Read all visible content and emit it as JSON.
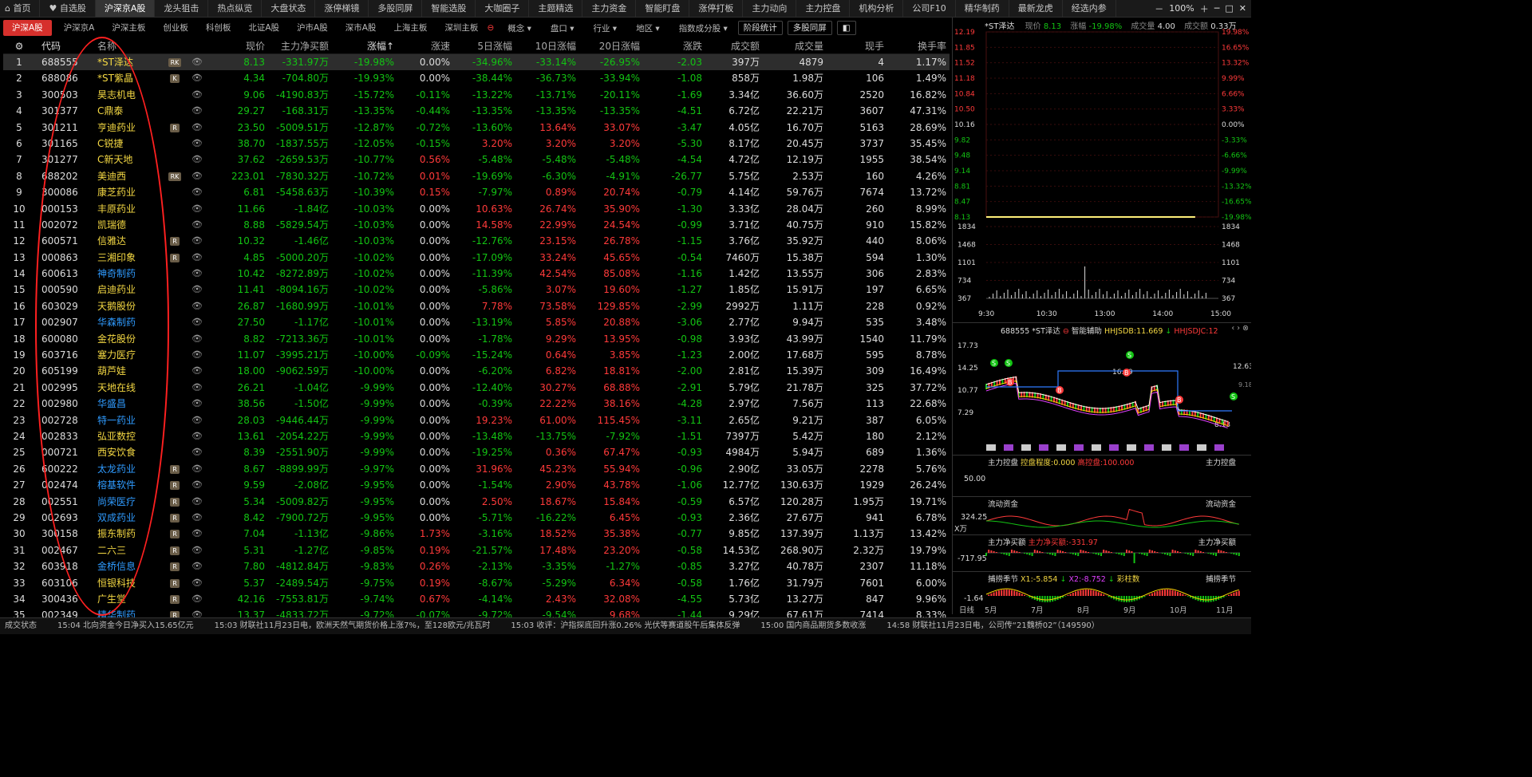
{
  "topnav": {
    "items": [
      "首页",
      "自选股",
      "沪深京A股",
      "龙头狙击",
      "热点纵览",
      "大盘状态",
      "涨停梯镜",
      "多股同屏",
      "智能选股",
      "大咖圈子",
      "主题精选",
      "主力资金",
      "智能盯盘",
      "涨停打板",
      "主力动向",
      "主力控盘",
      "机构分析",
      "公司F10",
      "精华制药",
      "最新龙虎",
      "经选内参"
    ],
    "active_index": 2,
    "zoom": "100%"
  },
  "subtabs": {
    "items": [
      "沪深A股",
      "沪深京A",
      "沪深主板",
      "创业板",
      "科创板",
      "北证A股",
      "沪市A股",
      "深市A股",
      "上海主板",
      "深圳主板"
    ],
    "active_index": 0,
    "dropdowns": [
      "概念",
      "盘口",
      "行业",
      "地区",
      "指数成分股"
    ],
    "buttons": [
      "阶段统计",
      "多股同屏"
    ]
  },
  "table": {
    "columns": [
      "代码",
      "名称",
      "现价",
      "主力净买额",
      "涨幅↑",
      "涨速",
      "5日涨幅",
      "10日涨幅",
      "20日涨幅",
      "涨跌",
      "成交额",
      "成交量",
      "现手",
      "换手率"
    ],
    "rows": [
      [
        "1",
        "688555",
        "*ST泽达",
        "RK",
        "8.13",
        "-331.97万",
        "-19.98%",
        "0.00%",
        "-34.96%",
        "-33.14%",
        "-26.95%",
        "-2.03",
        "397万",
        "4879",
        "4",
        "1.17%"
      ],
      [
        "2",
        "688086",
        "*ST紫晶",
        "K",
        "4.34",
        "-704.80万",
        "-19.93%",
        "0.00%",
        "-38.44%",
        "-36.73%",
        "-33.94%",
        "-1.08",
        "858万",
        "1.98万",
        "106",
        "1.49%"
      ],
      [
        "3",
        "300503",
        "昊志机电",
        "",
        "9.06",
        "-4190.83万",
        "-15.72%",
        "-0.11%",
        "-13.22%",
        "-13.71%",
        "-20.11%",
        "-1.69",
        "3.34亿",
        "36.60万",
        "2520",
        "16.82%"
      ],
      [
        "4",
        "301377",
        "C鼎泰",
        "",
        "29.27",
        "-168.31万",
        "-13.35%",
        "-0.44%",
        "-13.35%",
        "-13.35%",
        "-13.35%",
        "-4.51",
        "6.72亿",
        "22.21万",
        "3607",
        "47.31%"
      ],
      [
        "5",
        "301211",
        "亨迪药业",
        "R",
        "23.50",
        "-5009.51万",
        "-12.87%",
        "-0.72%",
        "-13.60%",
        "13.64%",
        "33.07%",
        "-3.47",
        "4.05亿",
        "16.70万",
        "5163",
        "28.69%"
      ],
      [
        "6",
        "301165",
        "C锐捷",
        "",
        "38.70",
        "-1837.55万",
        "-12.05%",
        "-0.15%",
        "3.20%",
        "3.20%",
        "3.20%",
        "-5.30",
        "8.17亿",
        "20.45万",
        "3737",
        "35.45%"
      ],
      [
        "7",
        "301277",
        "C新天地",
        "",
        "37.62",
        "-2659.53万",
        "-10.77%",
        "0.56%",
        "-5.48%",
        "-5.48%",
        "-5.48%",
        "-4.54",
        "4.72亿",
        "12.19万",
        "1955",
        "38.54%"
      ],
      [
        "8",
        "688202",
        "美迪西",
        "RK",
        "223.01",
        "-7830.32万",
        "-10.72%",
        "0.01%",
        "-19.69%",
        "-6.30%",
        "-4.91%",
        "-26.77",
        "5.75亿",
        "2.53万",
        "160",
        "4.26%"
      ],
      [
        "9",
        "300086",
        "康芝药业",
        "",
        "6.81",
        "-5458.63万",
        "-10.39%",
        "0.15%",
        "-7.97%",
        "0.89%",
        "20.74%",
        "-0.79",
        "4.14亿",
        "59.76万",
        "7674",
        "13.72%"
      ],
      [
        "10",
        "000153",
        "丰原药业",
        "",
        "11.66",
        "-1.84亿",
        "-10.03%",
        "0.00%",
        "10.63%",
        "26.74%",
        "35.90%",
        "-1.30",
        "3.33亿",
        "28.04万",
        "260",
        "8.99%"
      ],
      [
        "11",
        "002072",
        "凯瑞德",
        "",
        "8.88",
        "-5829.54万",
        "-10.03%",
        "0.00%",
        "14.58%",
        "22.99%",
        "24.54%",
        "-0.99",
        "3.71亿",
        "40.75万",
        "910",
        "15.82%"
      ],
      [
        "12",
        "600571",
        "信雅达",
        "R",
        "10.32",
        "-1.46亿",
        "-10.03%",
        "0.00%",
        "-12.76%",
        "23.15%",
        "26.78%",
        "-1.15",
        "3.76亿",
        "35.92万",
        "440",
        "8.06%"
      ],
      [
        "13",
        "000863",
        "三湘印象",
        "R",
        "4.85",
        "-5000.20万",
        "-10.02%",
        "0.00%",
        "-17.09%",
        "33.24%",
        "45.65%",
        "-0.54",
        "7460万",
        "15.38万",
        "594",
        "1.30%"
      ],
      [
        "14",
        "600613",
        "神奇制药",
        "",
        "10.42",
        "-8272.89万",
        "-10.02%",
        "0.00%",
        "-11.39%",
        "42.54%",
        "85.08%",
        "-1.16",
        "1.42亿",
        "13.55万",
        "306",
        "2.83%"
      ],
      [
        "15",
        "000590",
        "启迪药业",
        "",
        "11.41",
        "-8094.16万",
        "-10.02%",
        "0.00%",
        "-5.86%",
        "3.07%",
        "19.60%",
        "-1.27",
        "1.85亿",
        "15.91万",
        "197",
        "6.65%"
      ],
      [
        "16",
        "603029",
        "天鹅股份",
        "",
        "26.87",
        "-1680.99万",
        "-10.01%",
        "0.00%",
        "7.78%",
        "73.58%",
        "129.85%",
        "-2.99",
        "2992万",
        "1.11万",
        "228",
        "0.92%"
      ],
      [
        "17",
        "002907",
        "华森制药",
        "",
        "27.50",
        "-1.17亿",
        "-10.01%",
        "0.00%",
        "-13.19%",
        "5.85%",
        "20.88%",
        "-3.06",
        "2.77亿",
        "9.94万",
        "535",
        "3.48%"
      ],
      [
        "18",
        "600080",
        "金花股份",
        "",
        "8.82",
        "-7213.36万",
        "-10.01%",
        "0.00%",
        "-1.78%",
        "9.29%",
        "13.95%",
        "-0.98",
        "3.93亿",
        "43.99万",
        "1540",
        "11.79%"
      ],
      [
        "19",
        "603716",
        "塞力医疗",
        "",
        "11.07",
        "-3995.21万",
        "-10.00%",
        "-0.09%",
        "-15.24%",
        "0.64%",
        "3.85%",
        "-1.23",
        "2.00亿",
        "17.68万",
        "595",
        "8.78%"
      ],
      [
        "20",
        "605199",
        "葫芦娃",
        "",
        "18.00",
        "-9062.59万",
        "-10.00%",
        "0.00%",
        "-6.20%",
        "6.82%",
        "18.81%",
        "-2.00",
        "2.81亿",
        "15.39万",
        "309",
        "16.49%"
      ],
      [
        "21",
        "002995",
        "天地在线",
        "",
        "26.21",
        "-1.04亿",
        "-9.99%",
        "0.00%",
        "-12.40%",
        "30.27%",
        "68.88%",
        "-2.91",
        "5.79亿",
        "21.78万",
        "325",
        "37.72%"
      ],
      [
        "22",
        "002980",
        "华盛昌",
        "",
        "38.56",
        "-1.50亿",
        "-9.99%",
        "0.00%",
        "-0.39%",
        "22.22%",
        "38.16%",
        "-4.28",
        "2.97亿",
        "7.56万",
        "113",
        "22.68%"
      ],
      [
        "23",
        "002728",
        "特一药业",
        "",
        "28.03",
        "-9446.44万",
        "-9.99%",
        "0.00%",
        "19.23%",
        "61.00%",
        "115.45%",
        "-3.11",
        "2.65亿",
        "9.21万",
        "387",
        "6.05%"
      ],
      [
        "24",
        "002833",
        "弘亚数控",
        "",
        "13.61",
        "-2054.22万",
        "-9.99%",
        "0.00%",
        "-13.48%",
        "-13.75%",
        "-7.92%",
        "-1.51",
        "7397万",
        "5.42万",
        "180",
        "2.12%"
      ],
      [
        "25",
        "000721",
        "西安饮食",
        "",
        "8.39",
        "-2551.90万",
        "-9.99%",
        "0.00%",
        "-19.25%",
        "0.36%",
        "67.47%",
        "-0.93",
        "4984万",
        "5.94万",
        "689",
        "1.36%"
      ],
      [
        "26",
        "600222",
        "太龙药业",
        "R",
        "8.67",
        "-8899.99万",
        "-9.97%",
        "0.00%",
        "31.96%",
        "45.23%",
        "55.94%",
        "-0.96",
        "2.90亿",
        "33.05万",
        "2278",
        "5.76%"
      ],
      [
        "27",
        "002474",
        "榕基软件",
        "R",
        "9.59",
        "-2.08亿",
        "-9.95%",
        "0.00%",
        "-1.54%",
        "2.90%",
        "43.78%",
        "-1.06",
        "12.77亿",
        "130.63万",
        "1929",
        "26.24%"
      ],
      [
        "28",
        "002551",
        "尚荣医疗",
        "R",
        "5.34",
        "-5009.82万",
        "-9.95%",
        "0.00%",
        "2.50%",
        "18.67%",
        "15.84%",
        "-0.59",
        "6.57亿",
        "120.28万",
        "1.95万",
        "19.71%"
      ],
      [
        "29",
        "002693",
        "双成药业",
        "R",
        "8.42",
        "-7900.72万",
        "-9.95%",
        "0.00%",
        "-5.71%",
        "-16.22%",
        "6.45%",
        "-0.93",
        "2.36亿",
        "27.67万",
        "941",
        "6.78%"
      ],
      [
        "30",
        "300158",
        "振东制药",
        "R",
        "7.04",
        "-1.13亿",
        "-9.86%",
        "1.73%",
        "-3.16%",
        "18.52%",
        "35.38%",
        "-0.77",
        "9.85亿",
        "137.39万",
        "1.13万",
        "13.42%"
      ],
      [
        "31",
        "002467",
        "二六三",
        "R",
        "5.31",
        "-1.27亿",
        "-9.85%",
        "0.19%",
        "-21.57%",
        "17.48%",
        "23.20%",
        "-0.58",
        "14.53亿",
        "268.90万",
        "2.32万",
        "19.79%"
      ],
      [
        "32",
        "603918",
        "金桥信息",
        "R",
        "7.80",
        "-4812.84万",
        "-9.83%",
        "0.26%",
        "-2.13%",
        "-3.35%",
        "-1.27%",
        "-0.85",
        "3.27亿",
        "40.78万",
        "2307",
        "11.18%"
      ],
      [
        "33",
        "603106",
        "恒银科技",
        "R",
        "5.37",
        "-2489.54万",
        "-9.75%",
        "0.19%",
        "-8.67%",
        "-5.29%",
        "6.34%",
        "-0.58",
        "1.76亿",
        "31.79万",
        "7601",
        "6.00%"
      ],
      [
        "34",
        "300436",
        "广生堂",
        "R",
        "42.16",
        "-7553.81万",
        "-9.74%",
        "0.67%",
        "-4.14%",
        "2.43%",
        "32.08%",
        "-4.55",
        "5.73亿",
        "13.27万",
        "847",
        "9.96%"
      ],
      [
        "35",
        "002349",
        "精华制药",
        "R",
        "13.37",
        "-4833.72万",
        "-9.72%",
        "-0.07%",
        "-9.72%",
        "-9.54%",
        "9.68%",
        "-1.44",
        "9.29亿",
        "67.61万",
        "7414",
        "8.33%"
      ]
    ],
    "name_colors": [
      "#f4d843",
      "#f4d843",
      "#f4d843",
      "#f4d843",
      "#f4d843",
      "#f4d843",
      "#f4d843",
      "#f4d843",
      "#f4d843",
      "#f4d843",
      "#f4d843",
      "#f4d843",
      "#f4d843",
      "#2f9bff",
      "#f4d843",
      "#f4d843",
      "#2f9bff",
      "#f4d843",
      "#f4d843",
      "#f4d843",
      "#f4d843",
      "#2f9bff",
      "#2f9bff",
      "#f4d843",
      "#f4d843",
      "#2f9bff",
      "#2f9bff",
      "#2f9bff",
      "#2f9bff",
      "#f4d843",
      "#f4d843",
      "#2f9bff",
      "#f4d843",
      "#f4d843",
      "#2f9bff"
    ]
  },
  "right": {
    "intraday": {
      "name": "*ST泽达",
      "price_label": "现价",
      "price": "8.13",
      "chg_label": "涨幅",
      "chg": "-19.98%",
      "vol_label": "成交量",
      "vol": "4.00",
      "turnover_label": "成交额",
      "turnover": "0.33万",
      "left_axis": [
        "12.19",
        "11.85",
        "11.52",
        "11.18",
        "10.84",
        "10.50",
        "10.16",
        "9.82",
        "9.48",
        "9.14",
        "8.81",
        "8.47",
        "8.13"
      ],
      "right_axis": [
        "19.98%",
        "16.65%",
        "13.32%",
        "9.99%",
        "6.66%",
        "3.33%",
        "0.00%",
        "-3.33%",
        "-6.66%",
        "-9.99%",
        "-13.32%",
        "-16.65%",
        "-19.98%"
      ],
      "vol_axis": [
        "1834",
        "1468",
        "1101",
        "734",
        "367"
      ],
      "times": [
        "9:30",
        "10:30",
        "13:00",
        "14:00",
        "15:00"
      ],
      "price_level": 0.0
    },
    "kline": {
      "code": "688555",
      "name": "*ST泽达",
      "assist": "智能辅助",
      "ind1": "HHJSDB:11.669",
      "ind2": "HHJSDJC:12",
      "axis": [
        "17.73",
        "14.25",
        "10.77",
        "7.29"
      ],
      "high_label": "16.89",
      "low_label": "8.13",
      "right_label": "12.63",
      "right_label2": "9.18"
    },
    "control": {
      "title": "主力控盘",
      "deg": "控盘程度:0.000",
      "high": "高控盘:100.000",
      "axis": "50.00",
      "right": "主力控盘"
    },
    "flow": {
      "title": "流动资金",
      "right": "流动资金",
      "axis": "324.25",
      "unit": "X万"
    },
    "netbuy": {
      "title": "主力净买额",
      "value": "主力净买额:-331.97",
      "axis": "-717.95",
      "right": "主力净买额"
    },
    "season": {
      "title": "捕捞季节",
      "x1": "X1:-5.854",
      "x2": "X2:-8.752",
      "x3": "彩柱数",
      "axis": "-1.64",
      "right": "捕捞季节"
    },
    "months": [
      "日线",
      "5月",
      "7月",
      "8月",
      "9月",
      "10月",
      "11月"
    ]
  },
  "status": {
    "items": [
      "成交状态",
      "15:04 北向资金今日净买入15.65亿元",
      "15:03 财联社11月23日电，欧洲天然气期货价格上涨7%，至128欧元/兆瓦时",
      "15:03 收评：沪指探底回升涨0.26% 光伏等赛道股午后集体反弹",
      "15:00 国内商品期货多数收涨",
      "14:58 财联社11月23日电，公司传“21魏桥02”（149590）"
    ]
  },
  "colors": {
    "up": "#ff3a3a",
    "down": "#13c413",
    "accent": "#d6302c",
    "name": "#f4d843",
    "link": "#2f9bff",
    "annotation": "#ff2020"
  }
}
